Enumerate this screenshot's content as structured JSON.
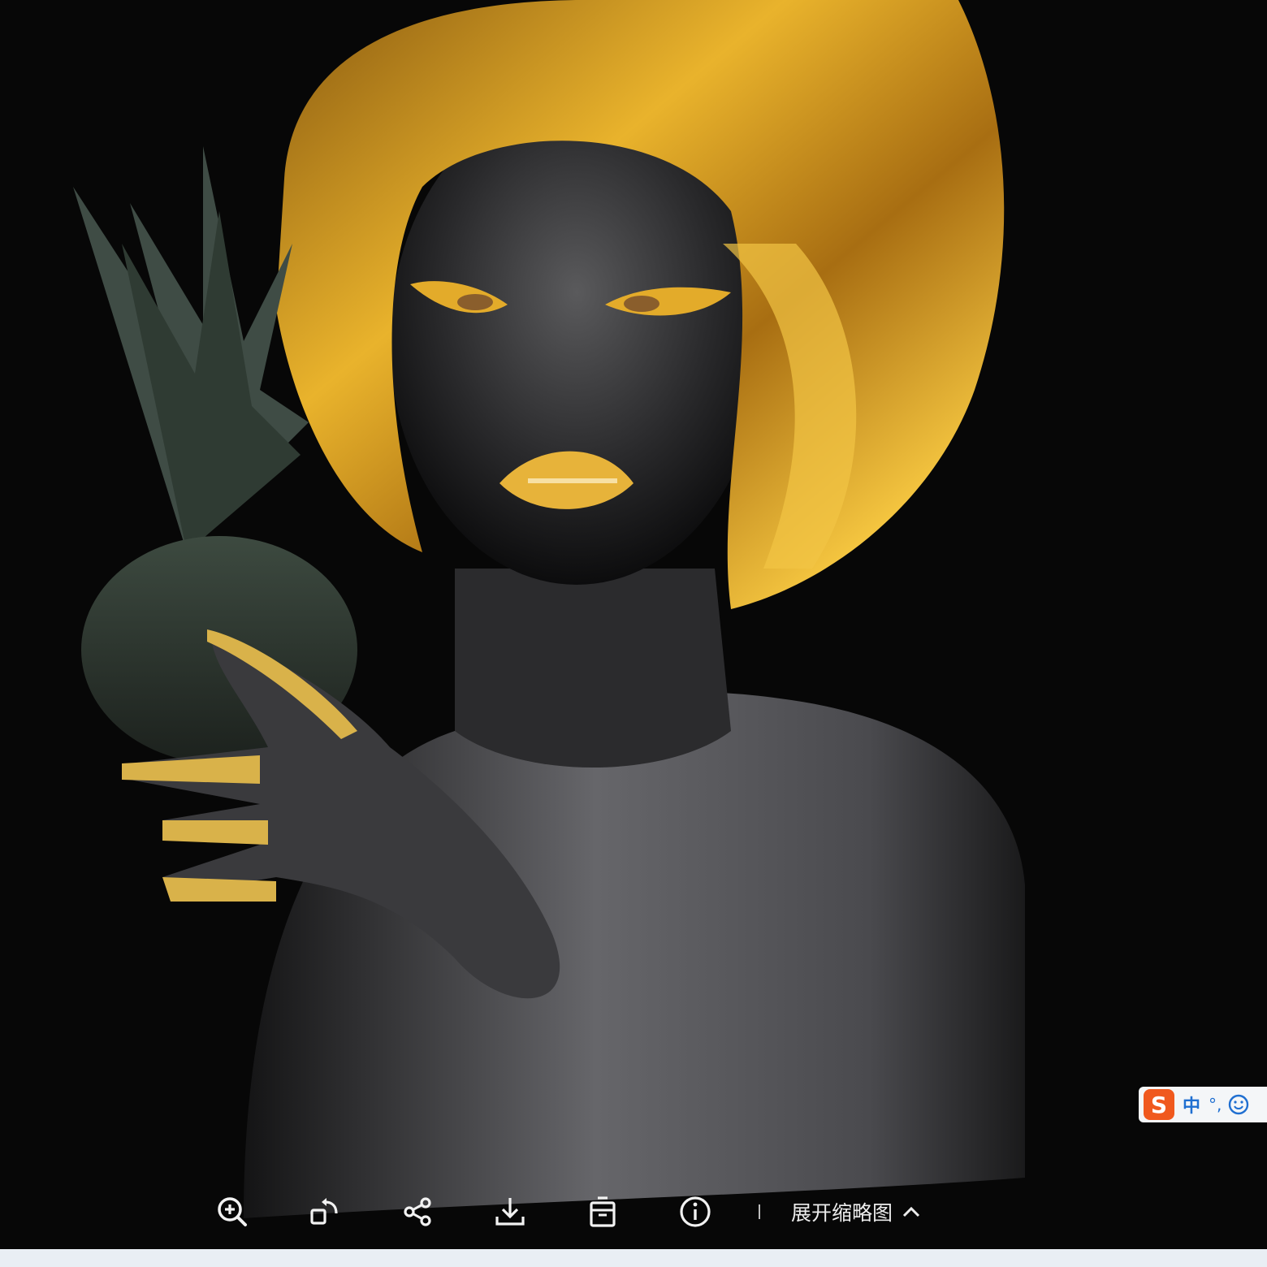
{
  "toolbar": {
    "zoom_icon": "zoom-in-icon",
    "rotate_icon": "rotate-icon",
    "share_icon": "share-icon",
    "download_icon": "download-icon",
    "delete_icon": "trash-icon",
    "info_icon": "info-icon",
    "expand_thumbnails_label": "展开缩略图",
    "expand_icon": "chevron-up-icon"
  },
  "ime": {
    "logo": "S",
    "mode": "中",
    "punct": "°,",
    "emoji_icon": "smiley-icon"
  },
  "colors": {
    "background": "#070707",
    "gold": "#d4a21c",
    "ime_orange": "#f0591e",
    "ime_blue": "#1f6fd1"
  }
}
